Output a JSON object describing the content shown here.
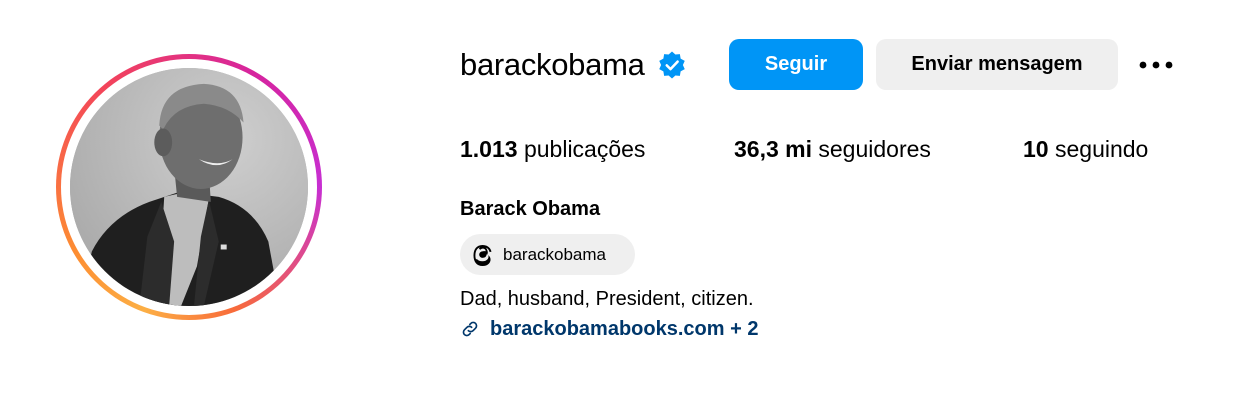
{
  "profile": {
    "username": "barackobama",
    "full_name": "Barack Obama",
    "verified_icon": "verified-badge-icon",
    "avatar_icon": "profile-photo",
    "follow_label": "Seguir",
    "message_label": "Enviar mensagem",
    "more_icon": "more-options-icon"
  },
  "stats": {
    "posts_count": "1.013",
    "posts_label": "publicações",
    "followers_count": "36,3 mi",
    "followers_label": "seguidores",
    "following_count": "10",
    "following_label": "seguindo"
  },
  "bio": {
    "threads_handle": "barackobama",
    "threads_icon": "threads-icon",
    "text": "Dad, husband, President, citizen.",
    "link_icon": "link-icon",
    "link_text": "barackobamabooks.com + 2"
  },
  "colors": {
    "follow_button": "#0095f6",
    "secondary_button": "#efefef",
    "link": "#00376b",
    "verified": "#0095f6"
  }
}
